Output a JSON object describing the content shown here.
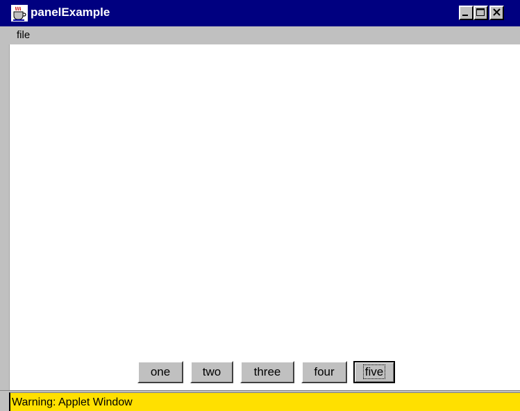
{
  "window": {
    "title": "panelExample",
    "icon": "java-coffee-cup-icon",
    "controls": {
      "minimize_icon": "minimize-icon",
      "maximize_icon": "maximize-icon",
      "close_icon": "close-icon"
    }
  },
  "menubar": {
    "items": [
      {
        "label": "file"
      }
    ]
  },
  "buttons": [
    {
      "label": "one"
    },
    {
      "label": "two"
    },
    {
      "label": "three"
    },
    {
      "label": "four"
    },
    {
      "label": "five",
      "focused": true
    }
  ],
  "status": {
    "text": "Warning: Applet Window",
    "color": "#ffe000"
  },
  "colors": {
    "titlebar": "#000080",
    "chrome": "#c0c0c0",
    "content": "#ffffff"
  }
}
